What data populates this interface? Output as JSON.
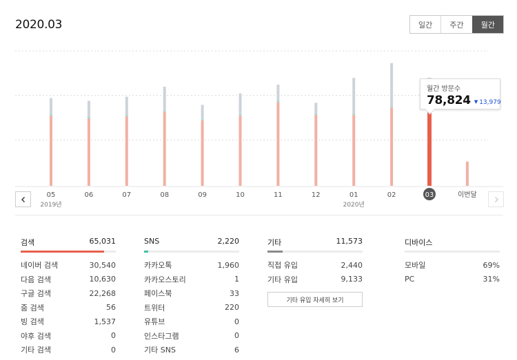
{
  "header": {
    "title": "2020.03"
  },
  "period_tabs": [
    {
      "label": "일간",
      "active": false
    },
    {
      "label": "주간",
      "active": false
    },
    {
      "label": "월간",
      "active": true
    }
  ],
  "chart_data": {
    "type": "bar",
    "categories": [
      "05",
      "06",
      "07",
      "08",
      "09",
      "10",
      "11",
      "12",
      "01",
      "02",
      "03",
      "이번달"
    ],
    "year_labels": [
      {
        "text": "2019년",
        "at": "05"
      },
      {
        "text": "2020년",
        "at": "01"
      }
    ],
    "series": [
      {
        "values": [
          52000,
          50000,
          51500,
          55000,
          48500,
          52000,
          62000,
          52500,
          52500,
          58000,
          65000,
          18000
        ]
      },
      {
        "values": [
          12000,
          12000,
          13500,
          17500,
          10500,
          15500,
          12000,
          8000,
          26500,
          32000,
          13824,
          0
        ]
      }
    ],
    "selected": "03",
    "colors": {
      "accent": "#e8604c",
      "accent_light": "#f2b0a4",
      "other": "#ced3da",
      "other_selected": "#9aa1ab",
      "separator": "#a8dccd"
    }
  },
  "tooltip": {
    "label": "월간 방문수",
    "value": "78,824",
    "delta": "13,979",
    "delta_direction": "down"
  },
  "icons": {
    "prev": "chevron-left-icon",
    "next": "chevron-right-icon"
  },
  "stats": {
    "search": {
      "title": "검색",
      "total": "65,031",
      "fill_fraction": 0.88,
      "bar_color": "#e8604c",
      "rows": [
        {
          "label": "네이버 검색",
          "value": "30,540"
        },
        {
          "label": "다음 검색",
          "value": "10,630"
        },
        {
          "label": "구글 검색",
          "value": "22,268"
        },
        {
          "label": "줌 검색",
          "value": "56"
        },
        {
          "label": "빙 검색",
          "value": "1,537"
        },
        {
          "label": "야후 검색",
          "value": "0"
        },
        {
          "label": "기타 검색",
          "value": "0"
        }
      ]
    },
    "sns": {
      "title": "SNS",
      "total": "2,220",
      "fill_fraction": 0.04,
      "bar_color": "#3fc1a0",
      "rows": [
        {
          "label": "카카오톡",
          "value": "1,960"
        },
        {
          "label": "카카오스토리",
          "value": "1"
        },
        {
          "label": "페이스북",
          "value": "33"
        },
        {
          "label": "트위터",
          "value": "220"
        },
        {
          "label": "유튜브",
          "value": "0"
        },
        {
          "label": "인스타그램",
          "value": "0"
        },
        {
          "label": "기타 SNS",
          "value": "6"
        }
      ]
    },
    "other": {
      "title": "기타",
      "total": "11,573",
      "fill_fraction": 0.16,
      "bar_color": "#888888",
      "rows": [
        {
          "label": "직접 유입",
          "value": "2,440"
        },
        {
          "label": "기타 유입",
          "value": "9,133"
        }
      ],
      "button_label": "기타 유입 자세히 보기"
    },
    "device": {
      "title": "디바이스",
      "rows": [
        {
          "label": "모바일",
          "value": "69%"
        },
        {
          "label": "PC",
          "value": "31%"
        }
      ]
    }
  }
}
